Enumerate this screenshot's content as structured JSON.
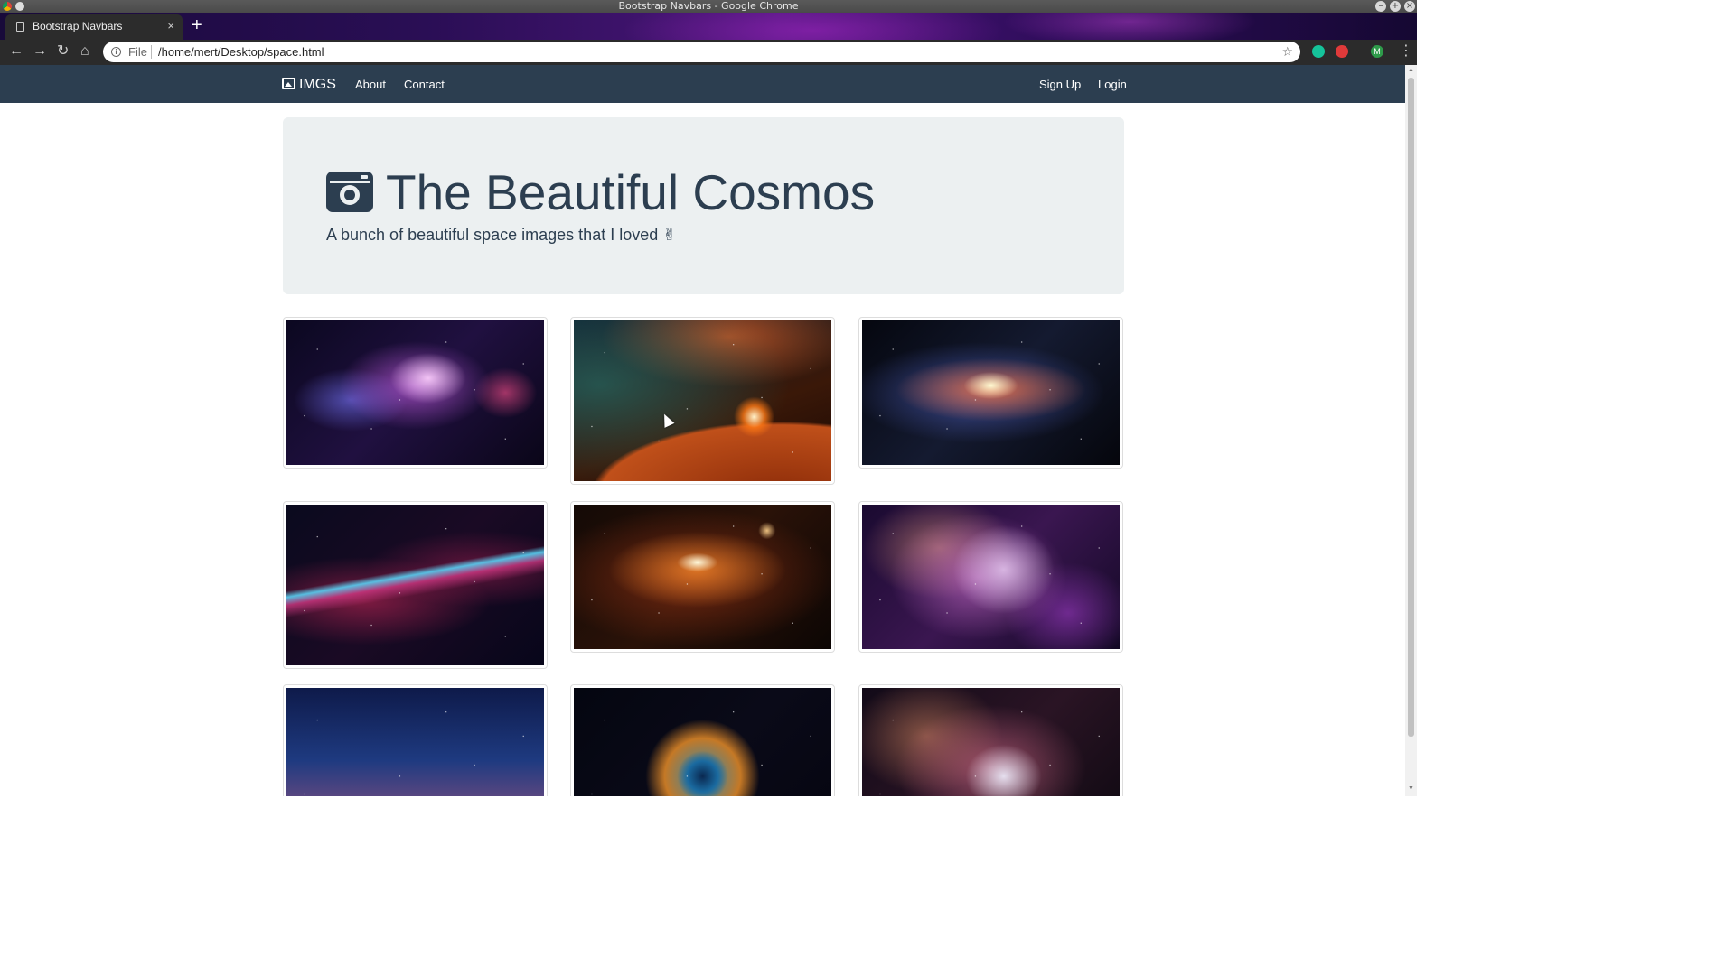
{
  "window": {
    "title": "Bootstrap Navbars - Google Chrome"
  },
  "browser": {
    "tab_title": "Bootstrap Navbars",
    "tab_close": "×",
    "new_tab": "+",
    "scheme_label": "File",
    "url": "/home/mert/Desktop/space.html",
    "extensions": [
      {
        "name": "grammarly-icon",
        "color": "#15c39a"
      },
      {
        "name": "adblock-icon",
        "color": "#e03a3a"
      },
      {
        "name": "profile-avatar",
        "color": "#2e9b4a",
        "letter": "M"
      }
    ]
  },
  "navbar": {
    "brand": "IMGS",
    "links": [
      "About",
      "Contact"
    ],
    "right_links": [
      "Sign Up",
      "Login"
    ],
    "background": "#2c3e50"
  },
  "jumbotron": {
    "title": "The Beautiful Cosmos",
    "subtitle": "A bunch of beautiful space images that I loved",
    "background": "#ecf0f1"
  },
  "gallery": {
    "images": [
      {
        "name": "purple-nebula"
      },
      {
        "name": "planet-sunrise"
      },
      {
        "name": "spiral-galaxy"
      },
      {
        "name": "veil-nebula"
      },
      {
        "name": "orange-galaxy-moons"
      },
      {
        "name": "pink-nebula"
      },
      {
        "name": "starry-mountain"
      },
      {
        "name": "helix-nebula"
      },
      {
        "name": "star-cluster"
      }
    ]
  }
}
